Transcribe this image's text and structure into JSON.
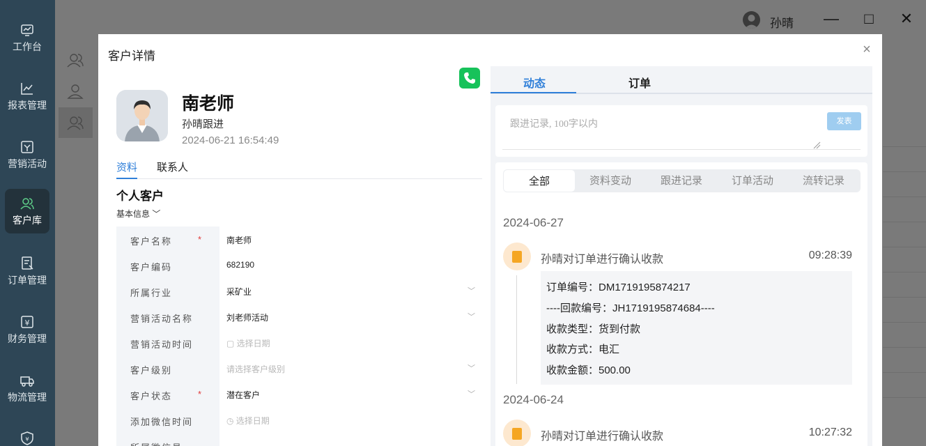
{
  "sidebar": {
    "items": [
      {
        "label": "工作台",
        "icon": "dashboard-icon"
      },
      {
        "label": "报表管理",
        "icon": "chart-line-icon"
      },
      {
        "label": "营销活动",
        "icon": "campaign-icon"
      },
      {
        "label": "客户库",
        "icon": "customers-icon",
        "active": true
      },
      {
        "label": "订单管理",
        "icon": "order-icon"
      },
      {
        "label": "财务管理",
        "icon": "finance-icon"
      },
      {
        "label": "物流管理",
        "icon": "truck-icon"
      },
      {
        "label": "",
        "icon": "shield-icon"
      }
    ]
  },
  "header": {
    "user_name": "孙晴",
    "minimize": "—",
    "maximize": "□",
    "close": "✕"
  },
  "modal": {
    "title": "客户详情",
    "close": "×",
    "customer": {
      "name": "南老师",
      "follow": "孙晴跟进",
      "time": "2024-06-21 16:54:49"
    },
    "left_tabs": [
      "资料",
      "联系人"
    ],
    "section_title": "个人客户",
    "section_sub": "基本信息 ﹀",
    "fields": [
      {
        "label": "客户名称",
        "required": "*",
        "value": "南老师",
        "placeholder": false,
        "chevron": ""
      },
      {
        "label": "客户编码",
        "required": "",
        "value": "682190",
        "placeholder": false,
        "chevron": ""
      },
      {
        "label": "所属行业",
        "required": "",
        "value": "采矿业",
        "placeholder": false,
        "chevron": "﹀"
      },
      {
        "label": "营销活动名称",
        "required": "",
        "value": "刘老师活动",
        "placeholder": false,
        "chevron": "﹀"
      },
      {
        "label": "营销活动时间",
        "required": "",
        "value": "▢ 选择日期",
        "placeholder": true,
        "chevron": ""
      },
      {
        "label": "客户级别",
        "required": "",
        "value": "请选择客户级别",
        "placeholder": true,
        "chevron": "﹀"
      },
      {
        "label": "客户状态",
        "required": "*",
        "value": "潜在客户",
        "placeholder": false,
        "chevron": "﹀"
      },
      {
        "label": "添加微信时间",
        "required": "",
        "value": "◷ 选择日期",
        "placeholder": true,
        "chevron": ""
      },
      {
        "label": "所属微信号",
        "required": "",
        "value": "",
        "placeholder": false,
        "chevron": ""
      }
    ],
    "right_tabs": [
      "动态",
      "订单"
    ],
    "comment": {
      "placeholder": "跟进记录, 100字以内",
      "send": "发表"
    },
    "filter_tabs": [
      "全部",
      "资料变动",
      "跟进记录",
      "订单活动",
      "流转记录"
    ],
    "timeline": [
      {
        "date": "2024-06-27",
        "title": "孙晴对订单进行确认收款",
        "time": "09:28:39",
        "details": [
          "订单编号：DM1719195874217",
          "----回款编号：JH1719195874684----",
          "收款类型：货到付款",
          "收款方式：电汇",
          "收款金额：500.00"
        ]
      },
      {
        "date": "2024-06-24",
        "title": "孙晴对订单进行确认收款",
        "time": "10:27:32"
      }
    ]
  }
}
